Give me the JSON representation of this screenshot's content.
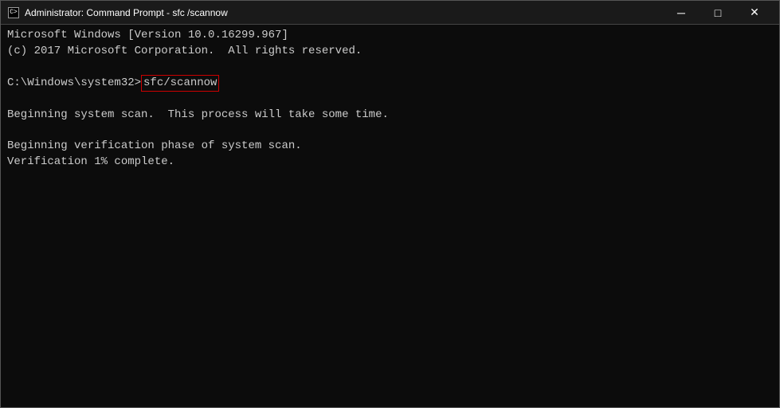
{
  "window": {
    "title": "Administrator: Command Prompt - sfc /scannow",
    "icon_label": "C>"
  },
  "title_buttons": {
    "minimize": "─",
    "maximize": "□",
    "close": "✕"
  },
  "console": {
    "line1": "Microsoft Windows [Version 10.0.16299.967]",
    "line2": "(c) 2017 Microsoft Corporation.  All rights reserved.",
    "line3_empty": "",
    "prompt": "C:\\Windows\\system32>",
    "command": "sfc/scannow",
    "line4_empty": "",
    "line5": "Beginning system scan.  This process will take some time.",
    "line6_empty": "",
    "line7": "Beginning verification phase of system scan.",
    "line8": "Verification 1% complete."
  }
}
